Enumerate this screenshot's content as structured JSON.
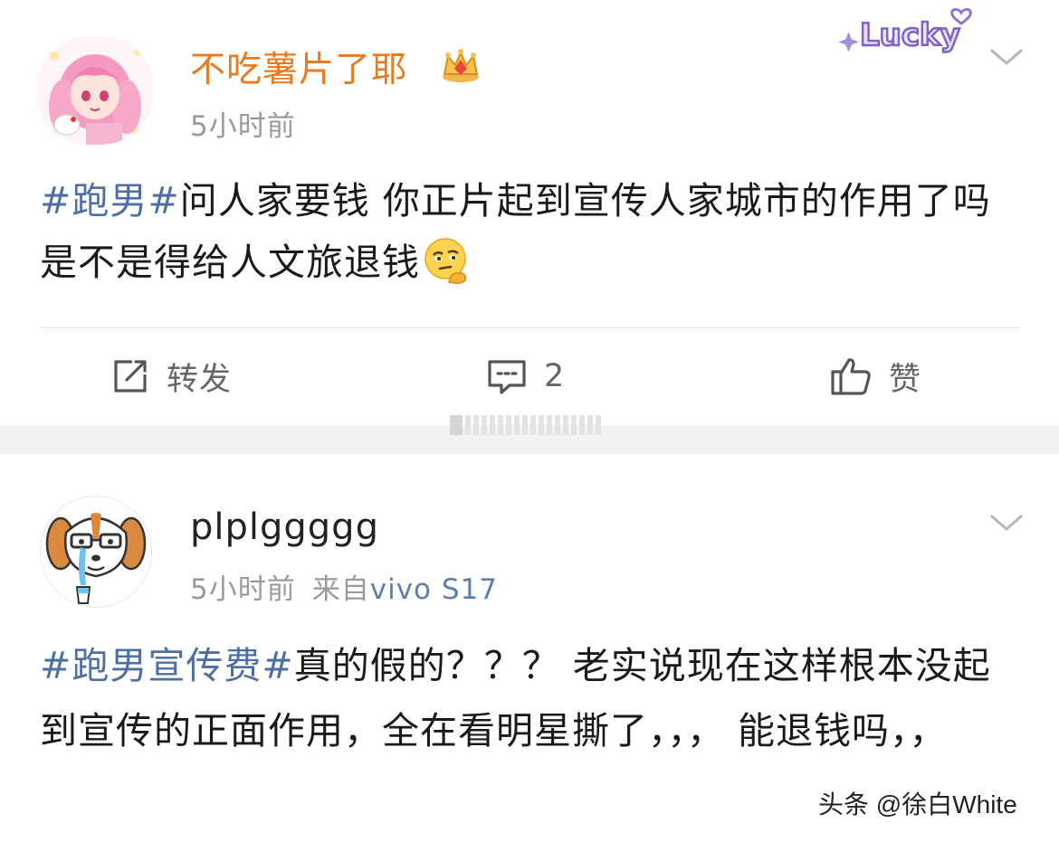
{
  "post1": {
    "username": "不吃薯片了耶",
    "time": "5小时前",
    "badge_text": "Lucky",
    "content": {
      "topic": "#跑男#",
      "text": "问人家要钱 你正片起到宣传人家城市的作用了吗 是不是得给人文旅退钱"
    },
    "actions": {
      "repost_label": "转发",
      "comment_count": "2",
      "like_label": "赞"
    }
  },
  "post2": {
    "username": "plplggggg",
    "time": "5小时前",
    "source_prefix": "来自",
    "device": "vivo S17",
    "content": {
      "topic": "#跑男宣传费#",
      "text": "真的假的？？？ 老实说现在这样根本没起到宣传的正面作用，全在看明星撕了，，， 能退钱吗，，"
    }
  },
  "watermark": "头条 @徐白White",
  "colors": {
    "username_vip": "#ea7a1f",
    "topic_link": "#4e6fa3",
    "meta_gray": "#9a9a9a",
    "device_link": "#5b7fb3"
  }
}
